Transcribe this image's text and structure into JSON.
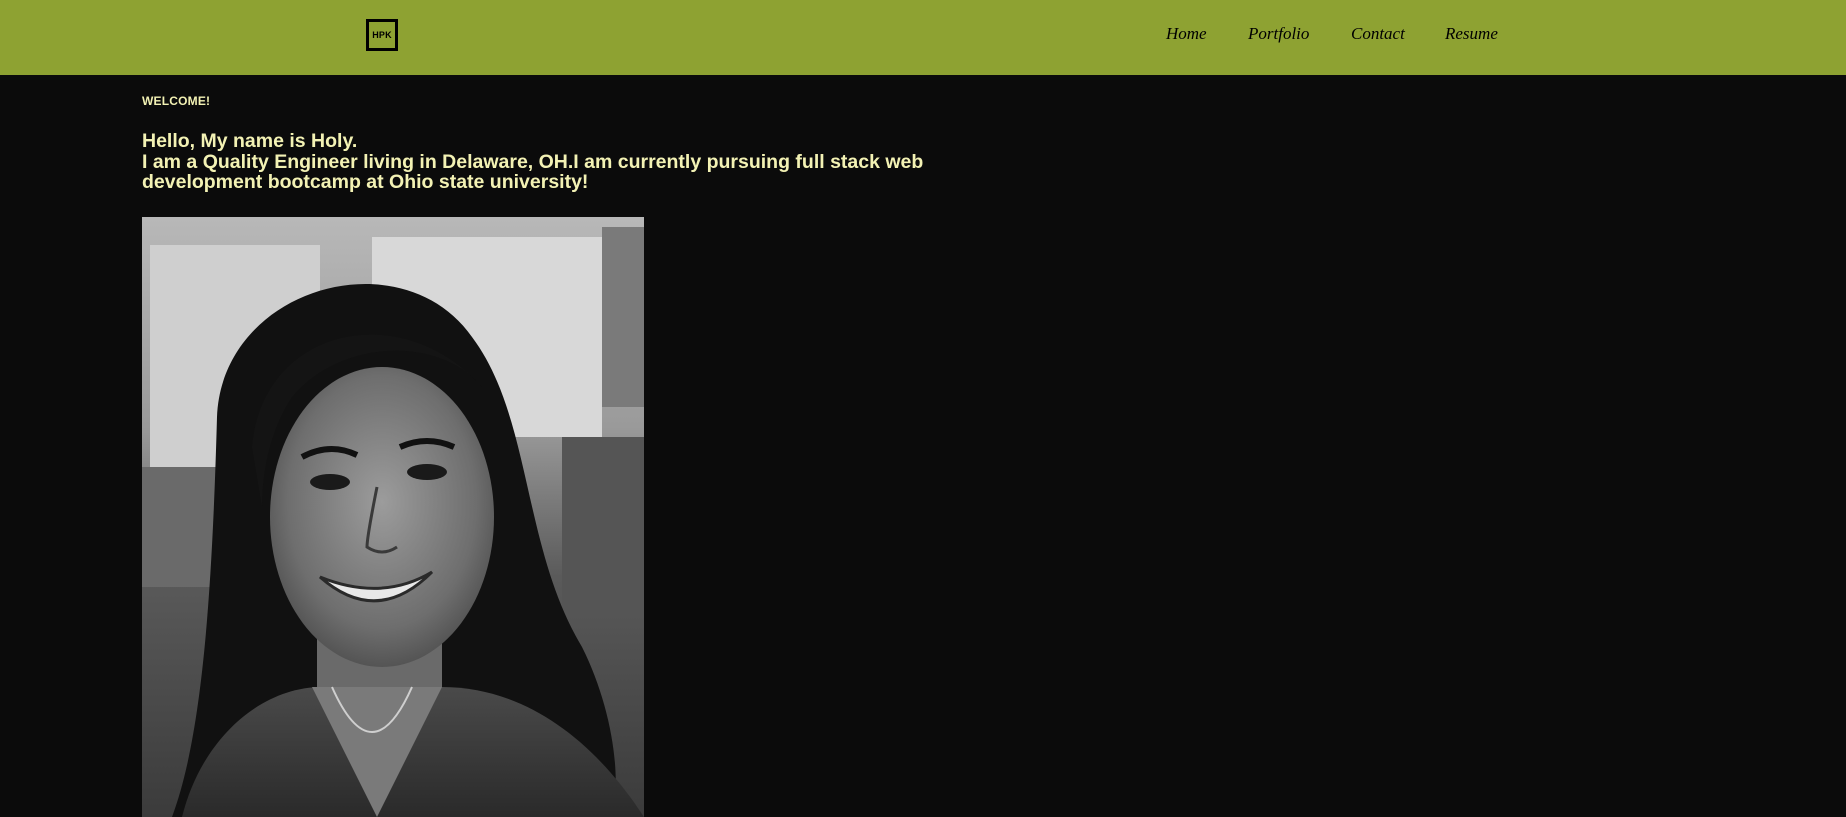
{
  "header": {
    "logo_text": "HPK",
    "nav": {
      "home": "Home",
      "portfolio": "Portfolio",
      "contact": "Contact",
      "resume": "Resume"
    }
  },
  "main": {
    "welcome": "WELCOME!",
    "intro_line1": "Hello, My name is Holy.",
    "intro_line2": "I am a Quality Engineer living in Delaware, OH.I am currently pursuing full stack web development bootcamp at Ohio state university!"
  },
  "colors": {
    "nav_bg": "#8ea232",
    "page_bg": "#0b0b0b",
    "text_accent": "#f3f2b4"
  }
}
